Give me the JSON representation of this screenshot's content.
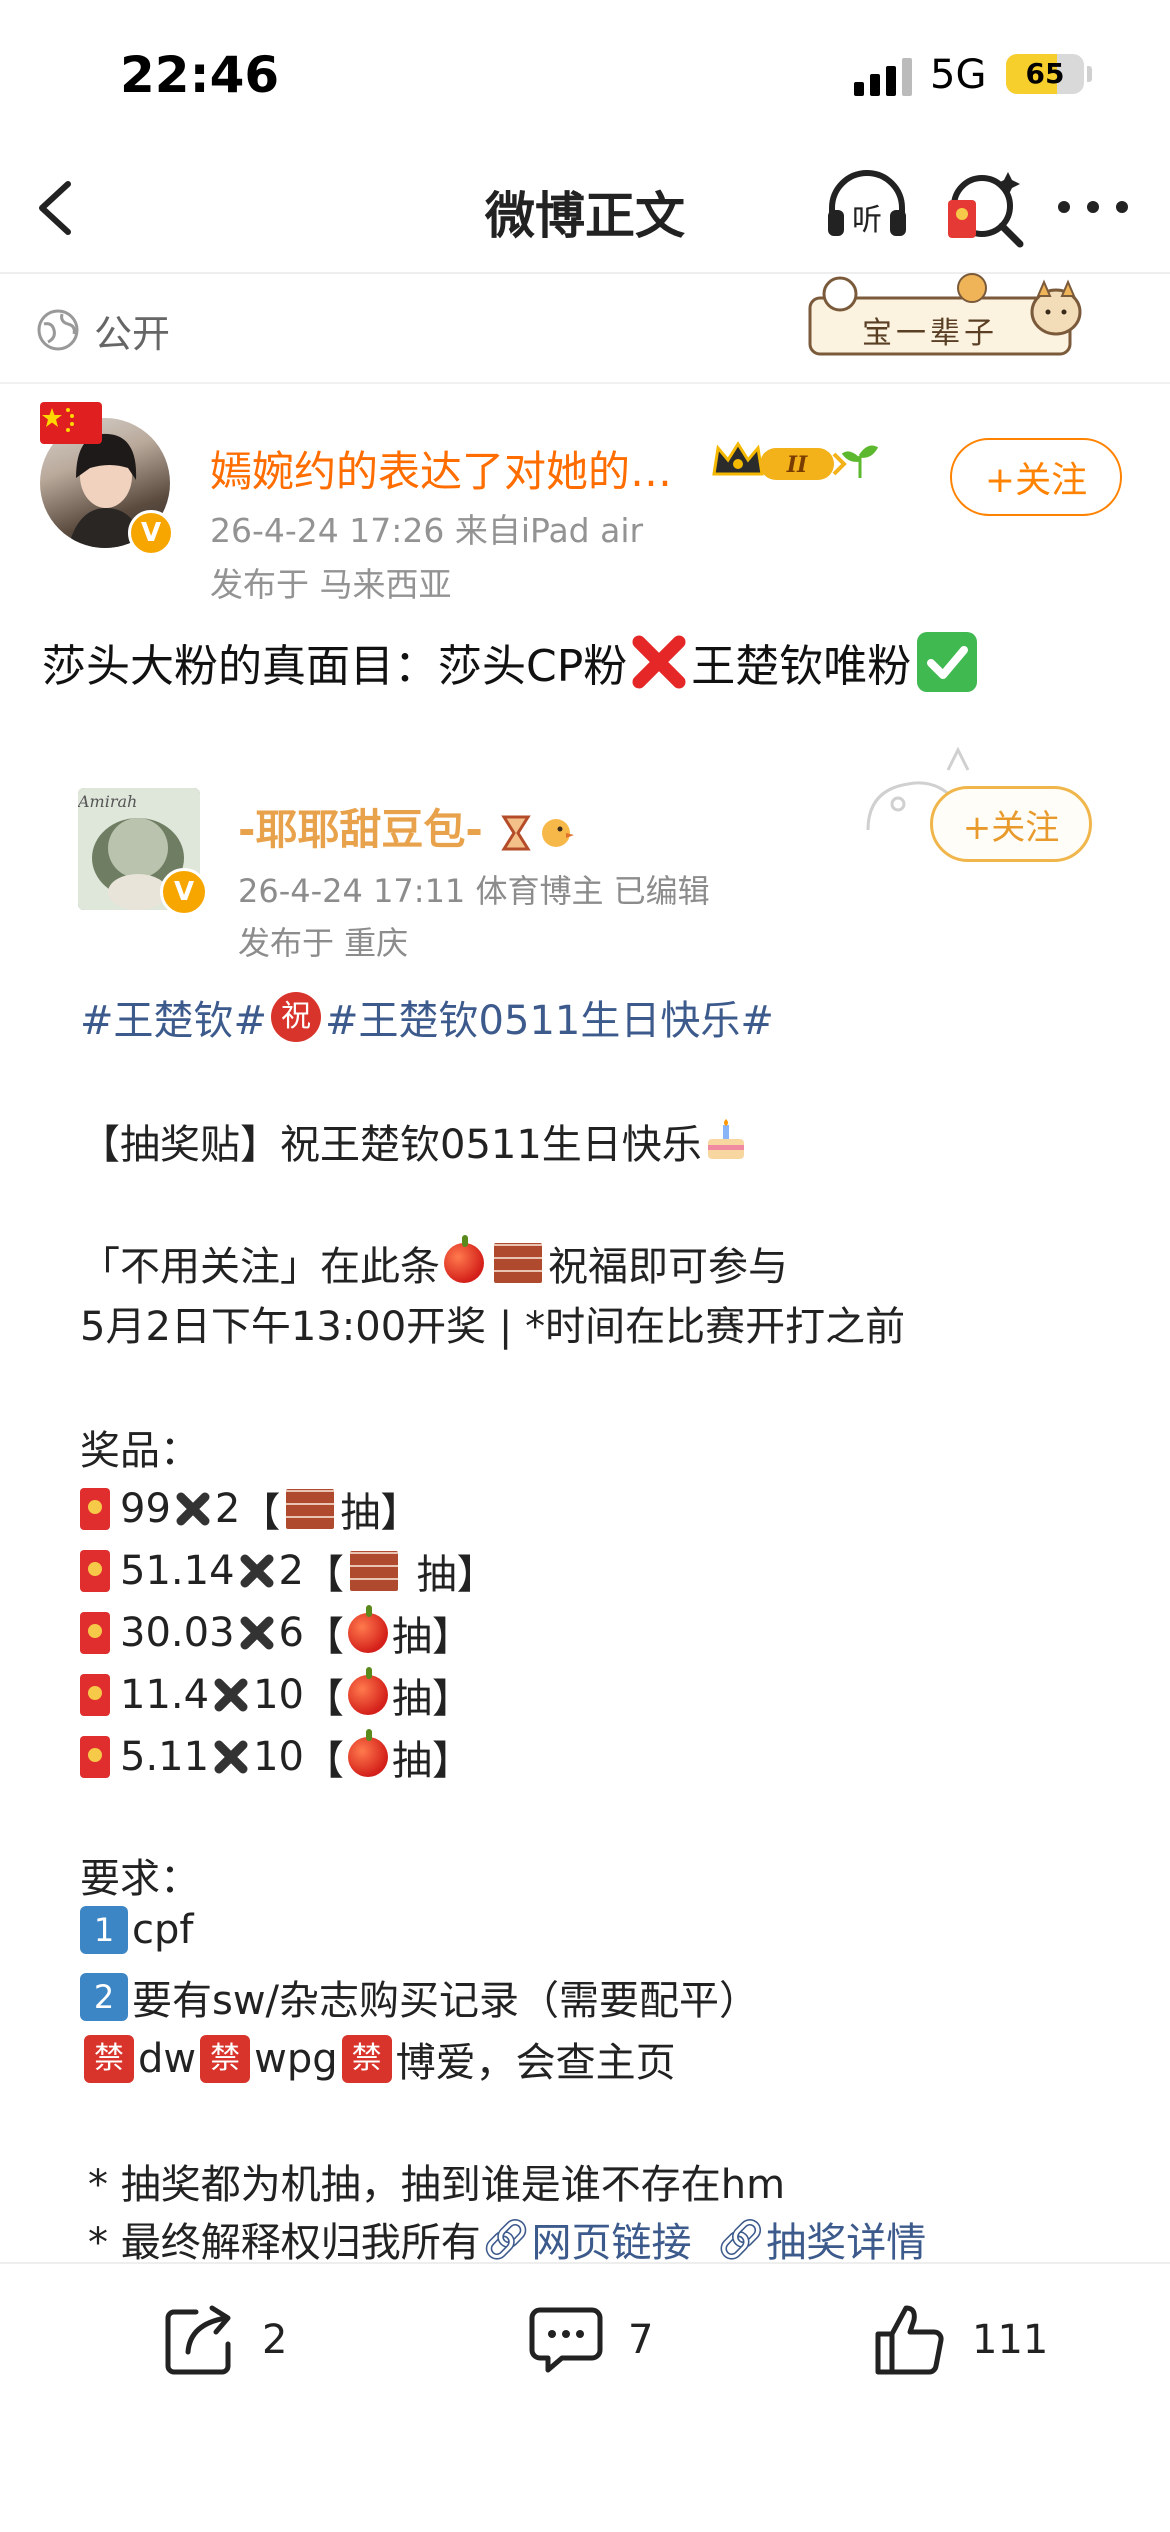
{
  "status_bar": {
    "time": "22:46",
    "network": "5G",
    "battery": "65",
    "battery_level": 0.65
  },
  "nav": {
    "title": "微博正文"
  },
  "visibility": {
    "label": "公开"
  },
  "sticker": {
    "text": "宝一辈子"
  },
  "author": {
    "name": "嫣婉约的表达了对她的…",
    "meta": "26-4-24 17:26  来自iPad air",
    "location": "发布于 马来西亚",
    "follow_label": "+关注",
    "level_badge": "II"
  },
  "post": {
    "text_part1": "莎头大粉的真面目：莎头CP粉",
    "text_part2": "王楚钦唯粉"
  },
  "embedded": {
    "name": "-耶耶甜豆包-",
    "meta": "26-4-24 17:11  体育博主  已编辑",
    "location": "发布于 重庆",
    "follow_label": "+关注",
    "avatar_caption": "Amirah",
    "tags_a": "#王楚钦#",
    "zhu_char": "祝",
    "tags_b": "#王楚钦0511生日快乐#",
    "title": "【抽奖贴】祝王楚钦0511生日快乐",
    "line1_a": "「不用关注」在此条",
    "line1_b": "祝福即可参与",
    "line2": "5月2日下午13:00开奖 | *时间在比赛开打之前",
    "prizes_label": "奖品：",
    "prizes": [
      {
        "amount": "99",
        "count": "2",
        "open": "【",
        "close": "抽】"
      },
      {
        "amount": "51.14",
        "count": "2",
        "open": "【",
        "close": " 抽】"
      },
      {
        "amount": "30.03",
        "count": "6",
        "open": "【",
        "close": "抽】"
      },
      {
        "amount": "11.4",
        "count": "10",
        "open": "【",
        "close": "抽】"
      },
      {
        "amount": "5.11",
        "count": "10",
        "open": "【",
        "close": "抽】"
      }
    ],
    "requirements_label": "要求：",
    "req1_key": "1",
    "req1": "cpf",
    "req2_key": "2",
    "req2": "要有sw/杂志购买记录（需要配平）",
    "jin_char": "禁",
    "req3_a": "dw",
    "req3_b": "wpg",
    "req3_c": "博爱，会查主页",
    "note1": "* 抽奖都为机抽，抽到谁是谁不存在hm",
    "note2_a": "* 最终解释权归我所有",
    "note2_link1": "网页链接",
    "note2_link2": "抽奖详情"
  },
  "actions": {
    "repost_count": "2",
    "comment_count": "7",
    "like_count": "111"
  },
  "colors": {
    "accent": "#ff8200",
    "author_name": "#ff6d00",
    "link": "#3d5a8c",
    "meta": "#939393"
  }
}
